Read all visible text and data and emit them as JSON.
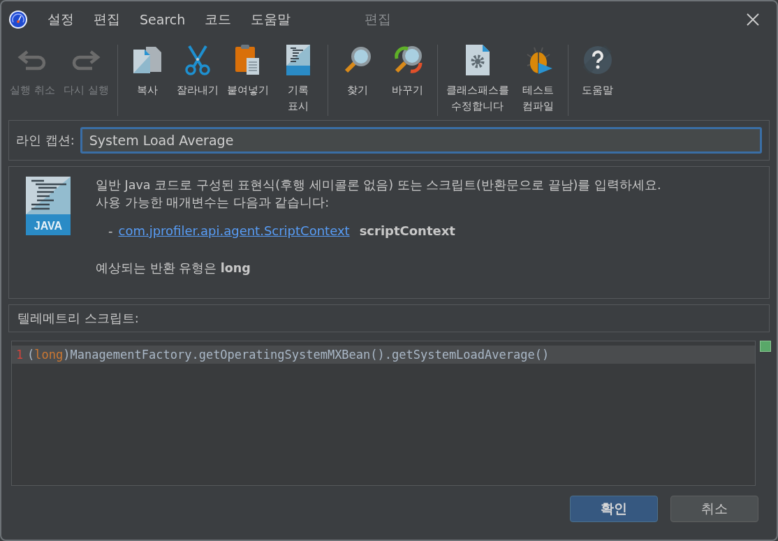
{
  "window": {
    "title": "편집"
  },
  "menu": [
    {
      "label": "설정"
    },
    {
      "label": "편집"
    },
    {
      "label": "Search"
    },
    {
      "label": "코드"
    },
    {
      "label": "도움말"
    }
  ],
  "toolbar": [
    [
      {
        "kind": "undo",
        "label": "실행 취소",
        "disabled": true
      },
      {
        "kind": "redo",
        "label": "다시 실행",
        "disabled": true
      }
    ],
    [
      {
        "kind": "copy",
        "label": "복사",
        "disabled": false
      },
      {
        "kind": "cut",
        "label": "잘라내기",
        "disabled": false
      },
      {
        "kind": "paste",
        "label": "붙여넣기",
        "disabled": false
      },
      {
        "kind": "java",
        "label": "기록\n표시",
        "disabled": false
      }
    ],
    [
      {
        "kind": "find",
        "label": "찾기",
        "disabled": false
      },
      {
        "kind": "replace",
        "label": "바꾸기",
        "disabled": false
      }
    ],
    [
      {
        "kind": "classpath",
        "label": "클래스패스를\n수정합니다",
        "disabled": false
      },
      {
        "kind": "compile",
        "label": "테스트\n컴파일",
        "disabled": false
      }
    ],
    [
      {
        "kind": "help",
        "label": "도움말",
        "disabled": false
      }
    ]
  ],
  "caption": {
    "label": "라인 캡션:",
    "value": "System Load Average"
  },
  "description": {
    "icon_label": "JAVA",
    "lines": [
      "일반 Java 코드로 구성된 표현식(후행 세미콜론 없음) 또는 스크립트(반환문으로 끝남)를 입력하세요.",
      "사용 가능한 매개변수는 다음과 같습니다:"
    ],
    "parameter": {
      "dash": "-",
      "type_link": "com.jprofiler.api.agent.ScriptContext",
      "name": "scriptContext"
    },
    "return_type": "예상되는 반환 유형은 **long**"
  },
  "script": {
    "label": "텔레메트리 스크립트:",
    "lines": [
      {
        "number": "1",
        "tokens": [
          {
            "kind": "punct",
            "text": "("
          },
          {
            "kind": "keyword",
            "text": "long"
          },
          {
            "kind": "plain",
            "text": ")ManagementFactory.getOperatingSystemMXBean().getSystemLoadAverage()"
          }
        ]
      }
    ]
  },
  "buttons": [
    {
      "label": "확인",
      "kind": "primary"
    },
    {
      "label": "취소",
      "kind": "secondary"
    }
  ]
}
